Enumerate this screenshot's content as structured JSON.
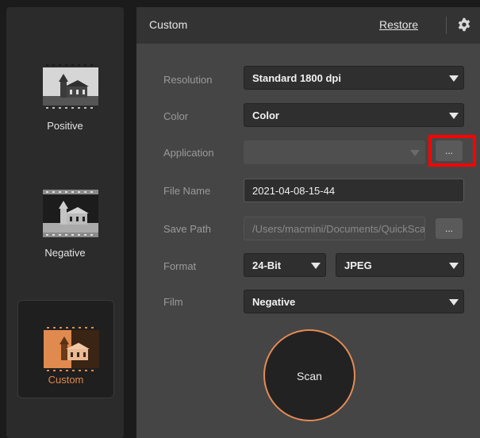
{
  "sidebar": {
    "modes": [
      {
        "label": "Positive",
        "icon": "church-film-icon"
      },
      {
        "label": "Negative",
        "icon": "church-film-icon"
      },
      {
        "label": "Custom",
        "icon": "church-film-icon",
        "selected": true
      }
    ]
  },
  "header": {
    "title": "Custom",
    "restore_label": "Restore",
    "settings_icon": "gear-icon"
  },
  "form": {
    "resolution": {
      "label": "Resolution",
      "value": "Standard 1800 dpi"
    },
    "color": {
      "label": "Color",
      "value": "Color"
    },
    "application": {
      "label": "Application",
      "value": "",
      "button_label": "..."
    },
    "file_name": {
      "label": "File Name",
      "value": "2021-04-08-15-44"
    },
    "save_path": {
      "label": "Save Path",
      "value": "/Users/macmini/Documents/QuickScan",
      "button_label": "..."
    },
    "format": {
      "label": "Format",
      "bit_depth": "24-Bit",
      "file_type": "JPEG"
    },
    "film": {
      "label": "Film",
      "value": "Negative"
    }
  },
  "scan_button": {
    "label": "Scan"
  },
  "colors": {
    "accent": "#e48b55",
    "highlight": "#ff0000",
    "panel_bg": "#454545"
  }
}
